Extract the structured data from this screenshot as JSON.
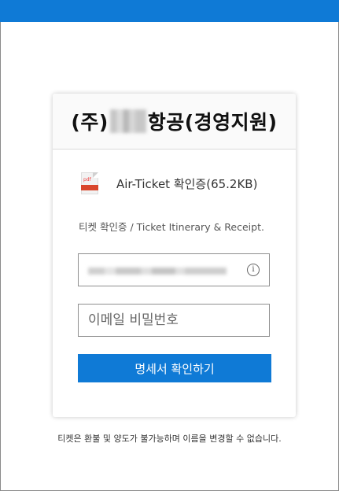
{
  "header": {
    "accent_color": "#0f7ad6"
  },
  "card": {
    "title_prefix": "(주)",
    "title_suffix": "항공(경영지원)"
  },
  "attachment": {
    "icon": "pdf-file-icon",
    "icon_label": "pdf",
    "name": "Air-Ticket 확인증(65.2KB)"
  },
  "subtitle": "티켓 확인증 / Ticket Itinerary & Receipt.",
  "email_field": {
    "info_icon": "i"
  },
  "password_field": {
    "placeholder": "이메일 비밀번호"
  },
  "submit_button": {
    "label": "명세서 확인하기"
  },
  "footer_note": "티켓은 환불 및 양도가 불가능하며 이름을 변경할 수 없습니다."
}
